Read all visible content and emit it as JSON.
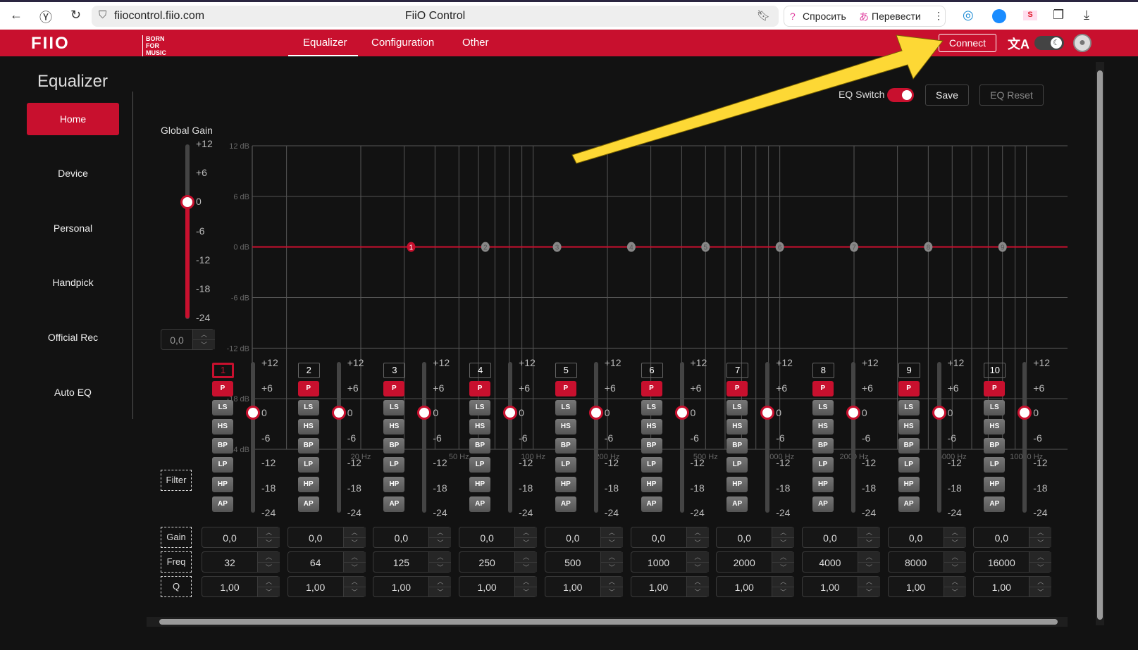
{
  "browser": {
    "url": "fiiocontrol.fiio.com",
    "title": "FiiO Control",
    "ask": "Спросить",
    "translate": "Перевести"
  },
  "header": {
    "logo": "FiiO BORN FOR MUSIC",
    "tabs": [
      {
        "label": "Equalizer",
        "active": true
      },
      {
        "label": "Configuration"
      },
      {
        "label": "Other"
      }
    ],
    "connect": "Connect"
  },
  "sidebar": {
    "title": "Equalizer",
    "items": [
      {
        "label": "Home",
        "active": true
      },
      {
        "label": "Device"
      },
      {
        "label": "Personal"
      },
      {
        "label": "Handpick"
      },
      {
        "label": "Official Rec"
      },
      {
        "label": "Auto EQ"
      }
    ]
  },
  "controls": {
    "eq_switch": "EQ Switch",
    "eq_switch_on": true,
    "save": "Save",
    "reset": "EQ Reset"
  },
  "global_gain": {
    "label": "Global Gain",
    "value": "0,0",
    "level_db": 0,
    "ticks": [
      "+12",
      "+6",
      "0",
      "-6",
      "-12",
      "-18",
      "-24"
    ]
  },
  "graph": {
    "y_ticks": [
      "12 dB",
      "6 dB",
      "0 dB",
      "-6 dB",
      "-12 dB",
      "-18 dB",
      "-24 dB"
    ],
    "x_ticks": [
      "20 Hz",
      "50 Hz",
      "100 Hz",
      "200 Hz",
      "500 Hz",
      "1000 Hz",
      "2000 Hz",
      "5000 Hz",
      "10000 Hz"
    ],
    "curve_db": 0,
    "accent": "#c8102e"
  },
  "band_ticks": [
    "+12",
    "+6",
    "0",
    "-6",
    "-12",
    "-18",
    "-24"
  ],
  "filters": [
    "P",
    "LS",
    "HS",
    "BP",
    "LP",
    "HP",
    "AP"
  ],
  "row_labels": {
    "filter": "Filter",
    "gain": "Gain",
    "freq": "Freq",
    "q": "Q"
  },
  "bands": [
    {
      "n": "1",
      "gain": "0,0",
      "freq": "32",
      "q": "1,00",
      "filter": "P",
      "selected": true
    },
    {
      "n": "2",
      "gain": "0,0",
      "freq": "64",
      "q": "1,00",
      "filter": "P"
    },
    {
      "n": "3",
      "gain": "0,0",
      "freq": "125",
      "q": "1,00",
      "filter": "P"
    },
    {
      "n": "4",
      "gain": "0,0",
      "freq": "250",
      "q": "1,00",
      "filter": "P"
    },
    {
      "n": "5",
      "gain": "0,0",
      "freq": "500",
      "q": "1,00",
      "filter": "P"
    },
    {
      "n": "6",
      "gain": "0,0",
      "freq": "1000",
      "q": "1,00",
      "filter": "P"
    },
    {
      "n": "7",
      "gain": "0,0",
      "freq": "2000",
      "q": "1,00",
      "filter": "P"
    },
    {
      "n": "8",
      "gain": "0,0",
      "freq": "4000",
      "q": "1,00",
      "filter": "P"
    },
    {
      "n": "9",
      "gain": "0,0",
      "freq": "8000",
      "q": "1,00",
      "filter": "P"
    },
    {
      "n": "10",
      "gain": "0,0",
      "freq": "16000",
      "q": "1,00",
      "filter": "P"
    }
  ]
}
